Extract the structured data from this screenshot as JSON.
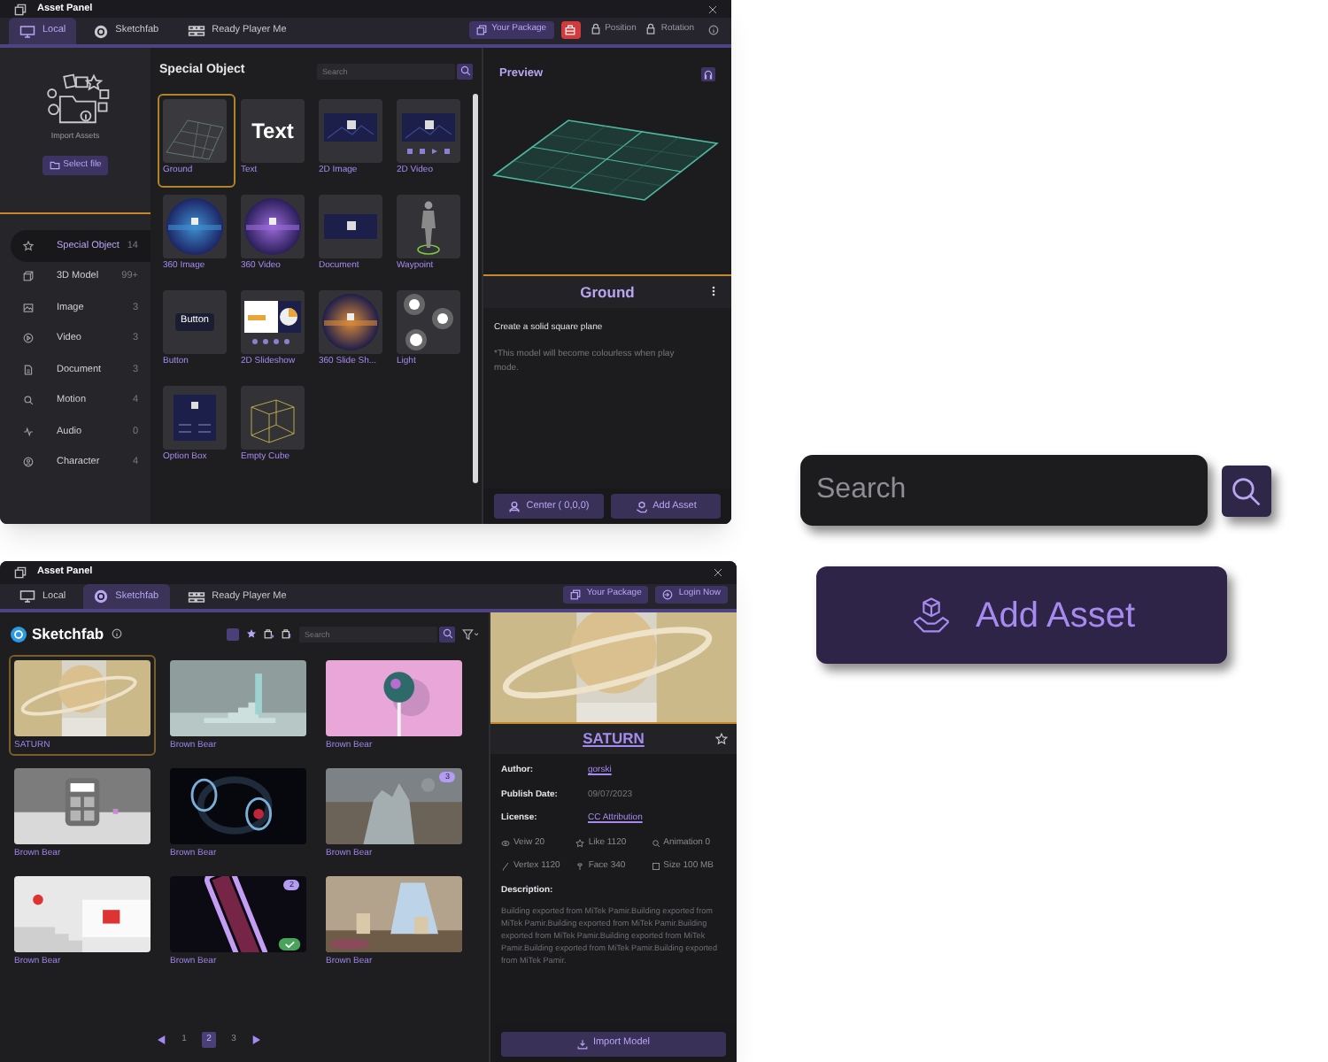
{
  "local_panel": {
    "title": "Asset Panel",
    "tabs": [
      {
        "label": "Local",
        "selected": true
      },
      {
        "label": "Sketchfab",
        "selected": false
      },
      {
        "label": "Ready Player Me",
        "selected": false
      }
    ],
    "toolbar": {
      "package_button": "Your Package",
      "position": "Position",
      "rotation": "Rotation"
    },
    "import": {
      "label": "Import Assets",
      "button": "Select file"
    },
    "categories": [
      {
        "label": "Special Object",
        "count": "14",
        "selected": true
      },
      {
        "label": "3D Model",
        "count": "99+",
        "selected": false
      },
      {
        "label": "Image",
        "count": "3",
        "selected": false
      },
      {
        "label": "Video",
        "count": "3",
        "selected": false
      },
      {
        "label": "Document",
        "count": "3",
        "selected": false
      },
      {
        "label": "Motion",
        "count": "4",
        "selected": false
      },
      {
        "label": "Audio",
        "count": "0",
        "selected": false
      },
      {
        "label": "Character",
        "count": "4",
        "selected": false
      }
    ],
    "grid": {
      "title": "Special Object",
      "search_placeholder": "Search",
      "items": [
        {
          "label": "Ground",
          "kind": "ground",
          "selected": true
        },
        {
          "label": "Text",
          "kind": "text",
          "thumb_text": "Text",
          "selected": false
        },
        {
          "label": "2D Image",
          "kind": "image2d",
          "selected": false
        },
        {
          "label": "2D Video",
          "kind": "video2d",
          "selected": false
        },
        {
          "label": "360 Image",
          "kind": "panorama",
          "selected": false
        },
        {
          "label": "360 Video",
          "kind": "video360",
          "selected": false
        },
        {
          "label": "Document",
          "kind": "document",
          "selected": false
        },
        {
          "label": "Waypoint",
          "kind": "waypoint",
          "selected": false
        },
        {
          "label": "Button",
          "kind": "button",
          "thumb_text": "Button",
          "selected": false
        },
        {
          "label": "2D Slideshow",
          "kind": "slideshow",
          "selected": false
        },
        {
          "label": "360 Slide Sh...",
          "kind": "slide360",
          "selected": false
        },
        {
          "label": "Light",
          "kind": "light",
          "selected": false
        },
        {
          "label": "Option Box",
          "kind": "optionbox",
          "selected": false
        },
        {
          "label": "Empty Cube",
          "kind": "cube",
          "selected": false
        }
      ]
    },
    "preview": {
      "title": "Preview",
      "name": "Ground",
      "description": "Create a solid square plane",
      "note": "*This model will become colourless when play mode.",
      "buttons": [
        "Center ( 0,0,0)",
        "Add Asset"
      ]
    }
  },
  "sketchfab_panel": {
    "title": "Asset Panel",
    "tabs": [
      {
        "label": "Local",
        "selected": false
      },
      {
        "label": "Sketchfab",
        "selected": true
      },
      {
        "label": "Ready Player Me",
        "selected": false
      }
    ],
    "toolbar": {
      "package_button": "Your Package",
      "login_button": "Login Now"
    },
    "header": {
      "title": "Sketchfab",
      "search_placeholder": "Search"
    },
    "models": [
      {
        "label": "SATURN",
        "selected": true,
        "checked": false
      },
      {
        "label": "Brown Bear",
        "selected": false,
        "checked": false
      },
      {
        "label": "Brown Bear",
        "selected": false,
        "checked": false
      },
      {
        "label": "Brown Bear",
        "selected": false,
        "checked": false
      },
      {
        "label": "Brown Bear",
        "selected": false,
        "checked": false
      },
      {
        "label": "Brown Bear",
        "selected": false,
        "checked": false,
        "badge": "3"
      },
      {
        "label": "Brown Bear",
        "selected": false,
        "checked": false
      },
      {
        "label": "Brown Bear",
        "selected": false,
        "checked": true,
        "badge": "2"
      },
      {
        "label": "Brown Bear",
        "selected": false,
        "checked": false
      }
    ],
    "pages": [
      {
        "label": "1",
        "selected": false
      },
      {
        "label": "2",
        "selected": true
      },
      {
        "label": "3",
        "selected": false
      }
    ],
    "detail": {
      "title": "SATURN",
      "fields": [
        {
          "label": "Author:",
          "value": "gorski",
          "kind": "link"
        },
        {
          "label": "Publish Date:",
          "value": "09/07/2023",
          "kind": "text"
        },
        {
          "label": "License:",
          "value": "CC Attribution",
          "kind": "link"
        }
      ],
      "stats": [
        "Veiw 20",
        "Like 1120",
        "Animation 0",
        "Vertex 1120",
        "Face 340",
        "Size 100 MB"
      ],
      "description_label": "Description:",
      "description": "Building exported from MiTek Pamir.Building exported from MiTek Pamir.Building exported from MiTek Pamir.Building exported from MiTek Pamir.Building exported from MiTek Pamir.Building exported from MiTek Pamir.Building exported from MiTek Pamir.",
      "button": "Import Model"
    }
  },
  "search_widget": {
    "placeholder": "Search"
  },
  "add_asset_button": {
    "label": "Add Asset"
  }
}
